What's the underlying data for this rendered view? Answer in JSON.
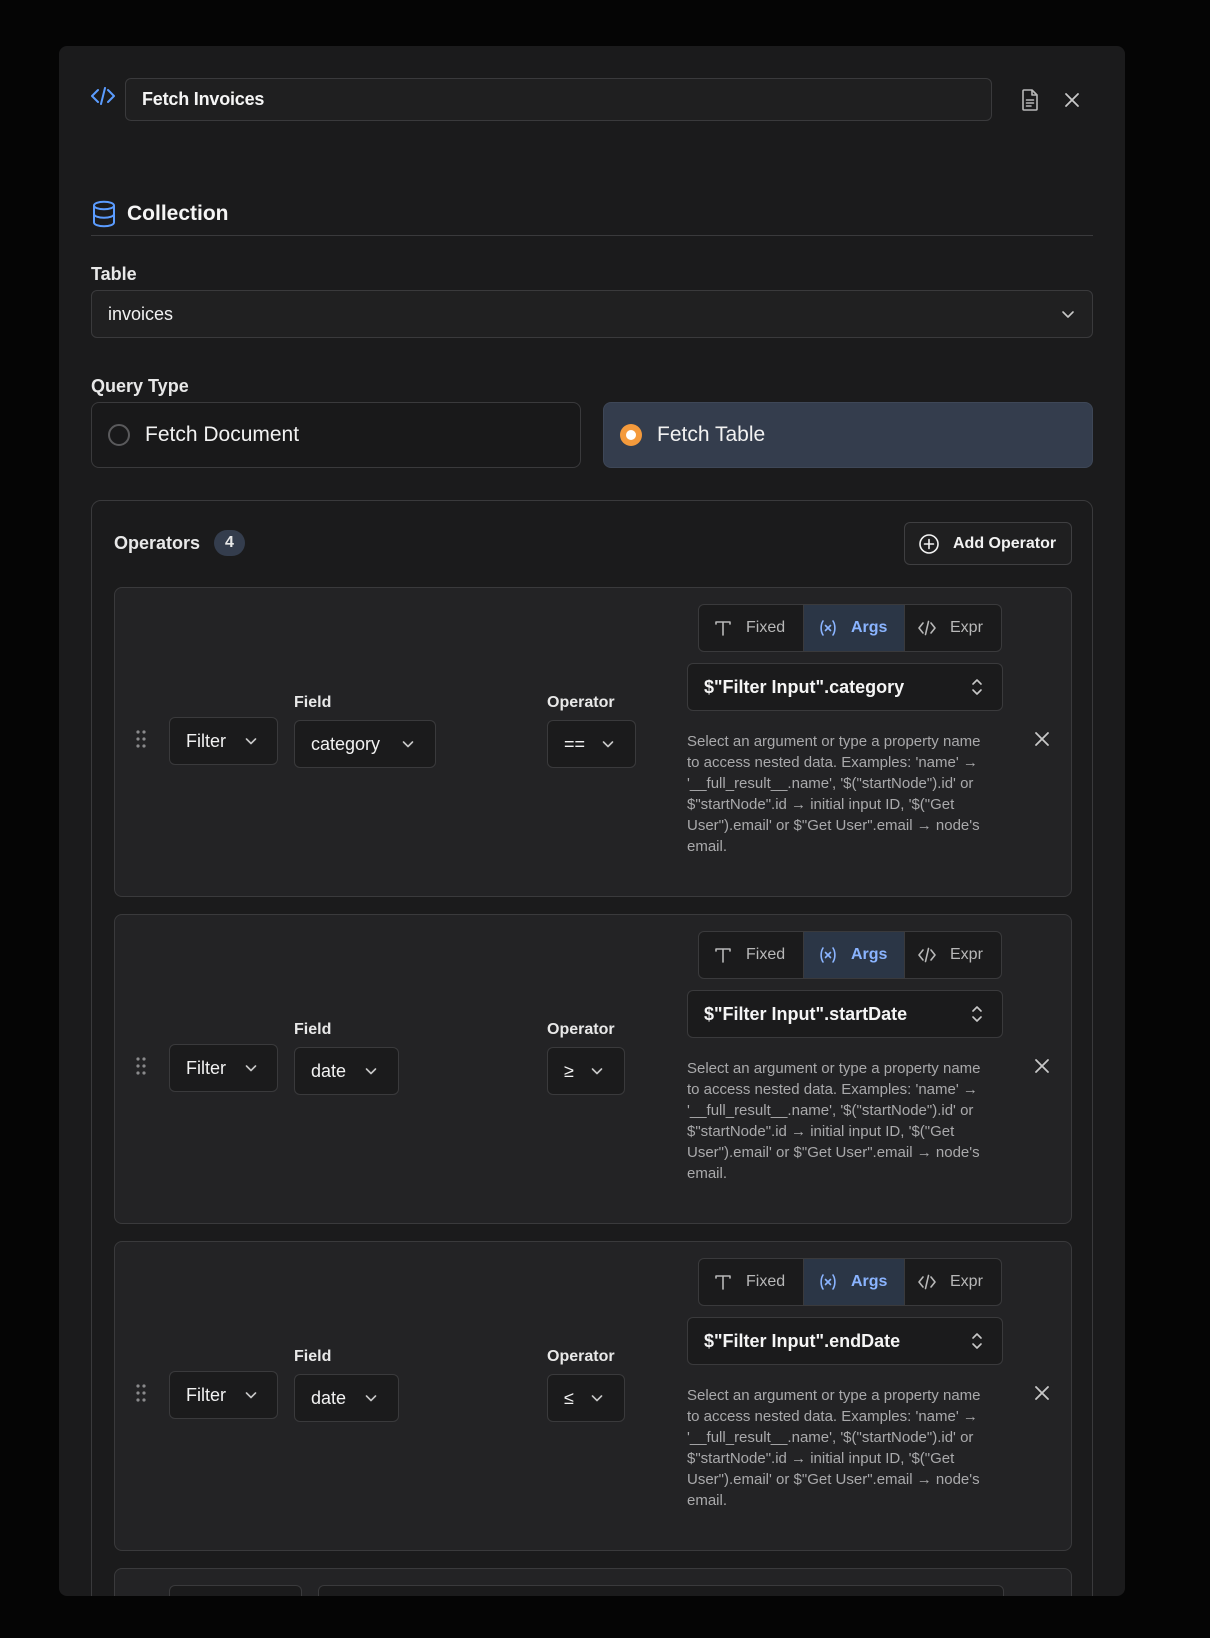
{
  "header": {
    "title": "Fetch Invoices"
  },
  "collection": {
    "section_title": "Collection",
    "table_label": "Table",
    "table_value": "invoices",
    "query_type_label": "Query Type",
    "query_types": [
      {
        "label": "Fetch Document",
        "selected": false
      },
      {
        "label": "Fetch Table",
        "selected": true
      }
    ]
  },
  "operators": {
    "title": "Operators",
    "count": "4",
    "add_label": "Add Operator",
    "mode_labels": {
      "fixed": "Fixed",
      "args": "Args",
      "expr": "Expr"
    },
    "field_label": "Field",
    "operator_label": "Operator",
    "items": [
      {
        "type": "Filter",
        "field": "category",
        "operator": "==",
        "mode": "Args",
        "value": "$\"Filter Input\".category",
        "help": "Select an argument or type a property name to access nested data. Examples: 'name' → '__full_result__.name', '$(\"startNode\").id' or $\"startNode\".id → initial input ID, '$(\"Get User\").email' or $\"Get User\".email → node's email."
      },
      {
        "type": "Filter",
        "field": "date",
        "operator": "≥",
        "mode": "Args",
        "value": "$\"Filter Input\".startDate",
        "help": "Select an argument or type a property name to access nested data. Examples: 'name' → '__full_result__.name', '$(\"startNode\").id' or $\"startNode\".id → initial input ID, '$(\"Get User\").email' or $\"Get User\".email → node's email."
      },
      {
        "type": "Filter",
        "field": "date",
        "operator": "≤",
        "mode": "Args",
        "value": "$\"Filter Input\".endDate",
        "help": "Select an argument or type a property name to access nested data. Examples: 'name' → '__full_result__.name', '$(\"startNode\").id' or $\"startNode\".id → initial input ID, '$(\"Get User\").email' or $\"Get User\".email → node's email."
      }
    ]
  },
  "colors": {
    "accent": "#8ab4ff",
    "radio_selected": "#f49a3c",
    "selected_bg": "#343d4d"
  }
}
